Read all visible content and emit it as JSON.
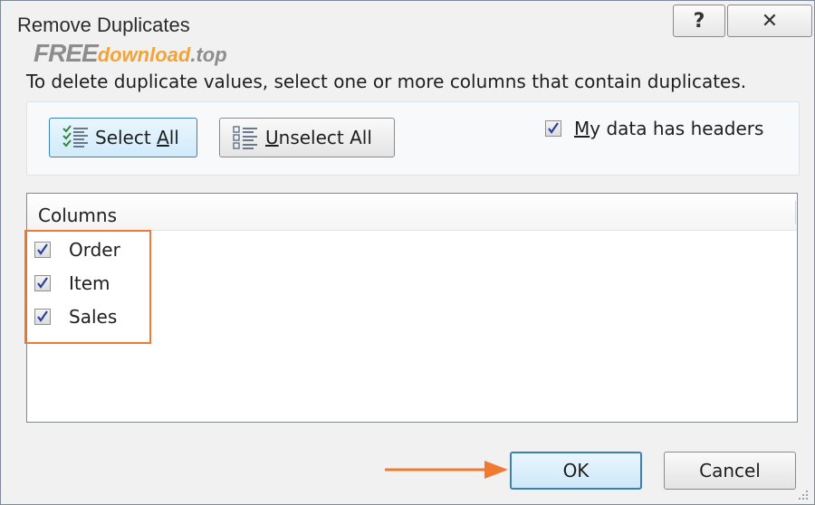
{
  "window": {
    "title": "Remove Duplicates",
    "help_glyph": "?",
    "close_glyph": "✕"
  },
  "watermark": {
    "free": "FREE",
    "rest": "download",
    "tld": ".top"
  },
  "instruction": "To delete duplicate values, select one or more columns that contain duplicates.",
  "buttons": {
    "select_all_pre": "Select ",
    "select_all_u": "A",
    "select_all_post": "ll",
    "unselect_all_u": "U",
    "unselect_all_post": "nselect All",
    "ok": "OK",
    "cancel": "Cancel"
  },
  "headers_option": {
    "label_u": "M",
    "label_rest": "y data has headers",
    "checked": true
  },
  "columns": {
    "header": "Columns",
    "items": [
      {
        "label": "Order",
        "checked": true
      },
      {
        "label": "Item",
        "checked": true
      },
      {
        "label": "Sales",
        "checked": true
      }
    ]
  },
  "colors": {
    "highlight": "#f07a32",
    "accent_button_border": "#3c7fb1",
    "checkmark": "#2a3f9e"
  }
}
